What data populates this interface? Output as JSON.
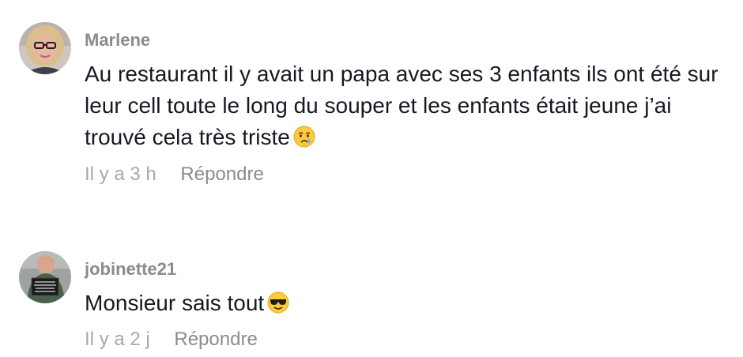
{
  "comments": [
    {
      "username": "Marlene",
      "text": "Au restaurant il y avait un papa avec ses 3 enfants ils ont été sur leur cell toute le long du souper et les enfants était jeune j’ai trouvé cela très triste",
      "emoji": "crying-face-icon",
      "time": "Il y a 3 h",
      "reply_label": "Répondre"
    },
    {
      "username": "jobinette21",
      "text": "Monsieur sais tout",
      "emoji": "sunglasses-face-icon",
      "time": "Il y a 2 j",
      "reply_label": "Répondre",
      "avatar_sign_text": [
        "ÉCOLE",
        "VAL-DES-MONTS",
        "2019 · 2020",
        "MATERNELLE"
      ]
    }
  ],
  "colors": {
    "text": "#161823",
    "username": "#8a8b91",
    "meta": "#a7a8ad",
    "emoji_face": "#ffcb3d"
  }
}
